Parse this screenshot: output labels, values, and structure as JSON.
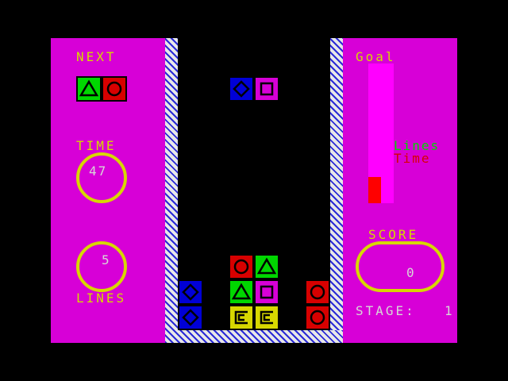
{
  "left_panel": {
    "next_label": "NEXT",
    "time_label": "TIME",
    "time_value": "47",
    "lines_value": "5",
    "lines_label": "LINES"
  },
  "right_panel": {
    "goal_label": "Goal",
    "legend_lines": "Lines",
    "legend_time": "Time",
    "score_label": "SCORE",
    "score_value": "0",
    "stage_label": "STAGE:",
    "stage_value": "1"
  },
  "colors": {
    "panel": "#d700d7",
    "yellow": "#d7d700",
    "blue": "#0000d7",
    "red": "#d70000",
    "green": "#00d700",
    "magenta": "#d700d7",
    "goal_bar": "#ff00ff"
  },
  "goal_meter": {
    "time_fraction": 0.19
  },
  "next_pieces": [
    {
      "color": "green",
      "symbol": "triangle"
    },
    {
      "color": "red",
      "symbol": "circle"
    }
  ],
  "falling_piece": [
    {
      "color": "blue",
      "symbol": "diamond"
    },
    {
      "color": "magenta",
      "symbol": "square"
    }
  ],
  "board": {
    "columns": 6,
    "rows": 11,
    "cells": [
      {
        "col": 0,
        "row": 9,
        "color": "blue",
        "symbol": "diamond"
      },
      {
        "col": 0,
        "row": 10,
        "color": "blue",
        "symbol": "diamond"
      },
      {
        "col": 2,
        "row": 8,
        "color": "red",
        "symbol": "circle"
      },
      {
        "col": 3,
        "row": 8,
        "color": "green",
        "symbol": "triangle"
      },
      {
        "col": 2,
        "row": 9,
        "color": "green",
        "symbol": "triangle"
      },
      {
        "col": 3,
        "row": 9,
        "color": "magenta",
        "symbol": "square"
      },
      {
        "col": 2,
        "row": 10,
        "color": "yellow",
        "symbol": "c-shape"
      },
      {
        "col": 3,
        "row": 10,
        "color": "yellow",
        "symbol": "c-shape"
      },
      {
        "col": 5,
        "row": 9,
        "color": "red",
        "symbol": "circle"
      },
      {
        "col": 5,
        "row": 10,
        "color": "red",
        "symbol": "circle"
      }
    ]
  }
}
